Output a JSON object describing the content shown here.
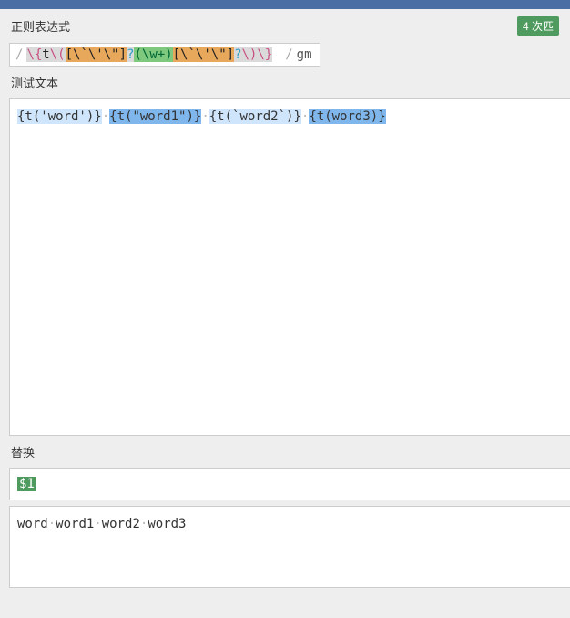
{
  "labels": {
    "regex": "正则表达式",
    "test": "测试文本",
    "replace": "替换"
  },
  "match_badge": "4 次匹",
  "flags": "gm",
  "regex": {
    "p1": "\\{",
    "p2": "t",
    "p3": "\\(",
    "p4": "[\\`\\'\\\"]",
    "p5": "?",
    "p6": "(\\w+)",
    "p7": "[\\`\\'\\\"]",
    "p8": "?",
    "p9": "\\)",
    "p10": "\\}"
  },
  "test_text": {
    "m1": "{t('word')}",
    "m2": "{t(\"word1\")}",
    "m3": "{t(`word2`)}",
    "m4": "{t(word3)}"
  },
  "replace_pattern": "$1",
  "result": {
    "w1": "word",
    "w2": "word1",
    "w3": "word2",
    "w4": "word3"
  }
}
